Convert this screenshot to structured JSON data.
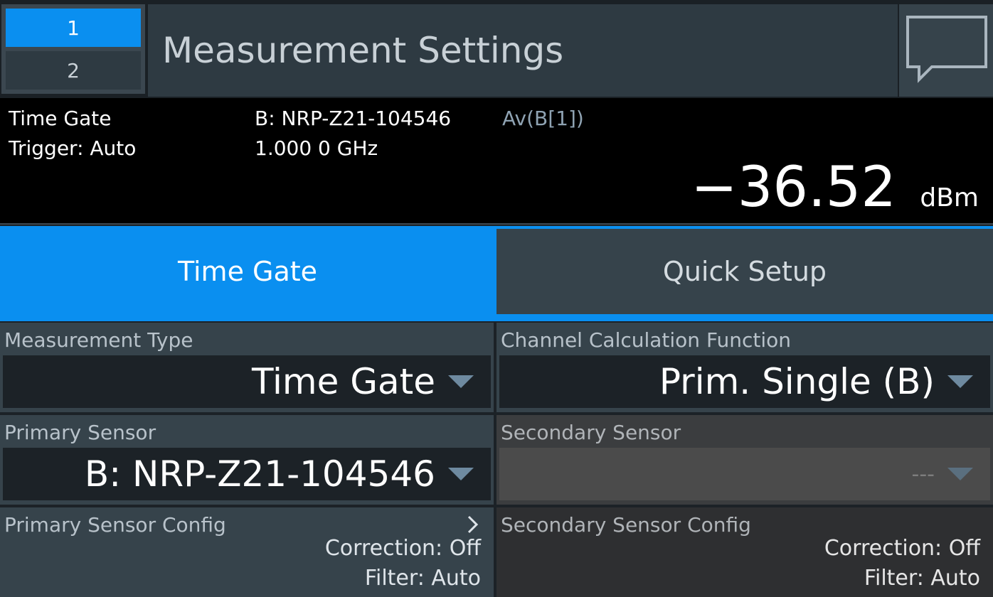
{
  "header": {
    "window_buttons": [
      "1",
      "2"
    ],
    "active_window": "1",
    "title": "Measurement Settings",
    "chat_icon": "speech-bubble-icon"
  },
  "info": {
    "mode": "Time Gate",
    "trigger": "Trigger: Auto",
    "sensor": "B: NRP-Z21-104546",
    "frequency": "1.000 0 GHz",
    "channel": "Av(B[1])",
    "reading_value": "−36.52",
    "reading_unit": "dBm"
  },
  "tabs": {
    "items": [
      {
        "label": "Time Gate",
        "active": true
      },
      {
        "label": "Quick Setup",
        "active": false
      }
    ]
  },
  "panels": {
    "measurement_type": {
      "label": "Measurement Type",
      "value": "Time Gate"
    },
    "channel_calc": {
      "label": "Channel Calculation Function",
      "value": "Prim. Single (B)"
    },
    "primary_sensor": {
      "label": "Primary Sensor",
      "value": "B: NRP-Z21-104546"
    },
    "secondary_sensor": {
      "label": "Secondary Sensor",
      "value": "---",
      "disabled": true
    },
    "primary_config": {
      "label": "Primary Sensor Config",
      "correction": "Correction: Off",
      "filter": "Filter: Auto"
    },
    "secondary_config": {
      "label": "Secondary Sensor Config",
      "correction": "Correction: Off",
      "filter": "Filter: Auto"
    }
  },
  "colors": {
    "accent": "#0a8ff0",
    "panel": "#36434b",
    "field": "#1c2227",
    "disabled_panel": "#3b3d3f"
  }
}
